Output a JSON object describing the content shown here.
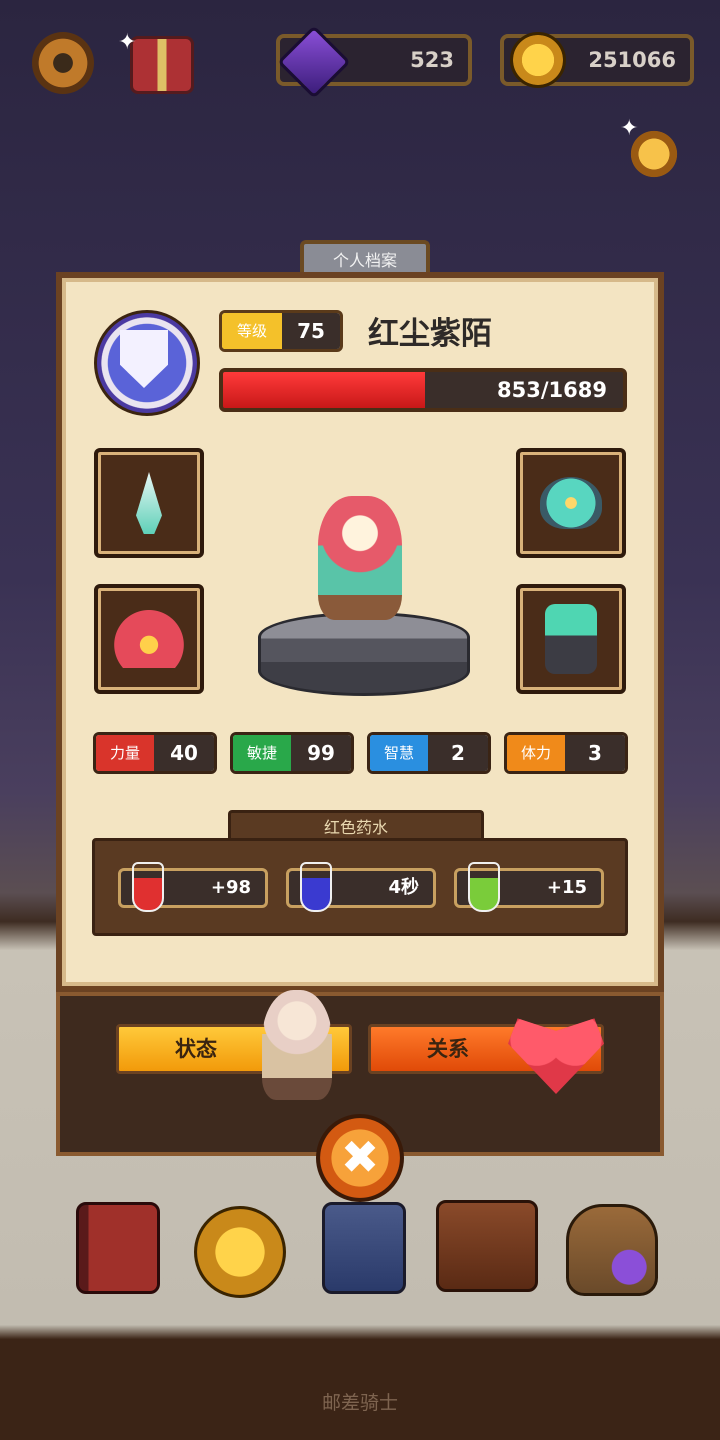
{
  "top_bar": {
    "gems": "523",
    "coins": "251066"
  },
  "profile": {
    "tab_title": "个人档案",
    "level_label": "等级",
    "level": "75",
    "name": "红尘紫陌",
    "hp_text": "853/1689",
    "hp_fraction": 0.505
  },
  "stats": [
    {
      "label": "力量",
      "value": "40",
      "color": "#d9342b"
    },
    {
      "label": "敏捷",
      "value": "99",
      "color": "#29a84a"
    },
    {
      "label": "智慧",
      "value": "2",
      "color": "#2a8fe0"
    },
    {
      "label": "体力",
      "value": "3",
      "color": "#f08a1a"
    }
  ],
  "potions": {
    "title": "红色药水",
    "items": [
      {
        "value": "+98",
        "icon": "heart-potion-icon",
        "color": "#e03030"
      },
      {
        "value": "4秒",
        "icon": "hourglass-potion-icon",
        "color": "#3a3ad0"
      },
      {
        "value": "+15",
        "icon": "shield-potion-icon",
        "color": "#7acc3a"
      }
    ]
  },
  "buttons": {
    "status": "状态",
    "relation": "关系",
    "close": "✖"
  },
  "footer_text": "邮差骑士",
  "colors": {
    "panel_bg": "#f3e4c2",
    "hp_red": "#e01e1e",
    "status_btn": "#f6b21a",
    "relation_btn": "#ef5a12"
  }
}
